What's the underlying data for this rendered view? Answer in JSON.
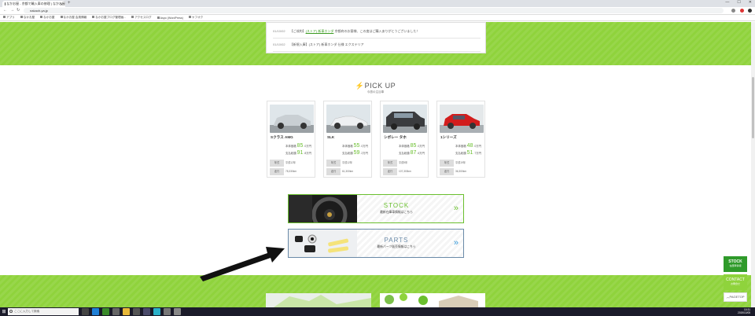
{
  "browser": {
    "tab_title": "なかお屋 - 京都で輸入車の修理 | なかお屋",
    "url": "nakaoh-ya.jp",
    "bookmarks": [
      "アプリ",
      "なかお屋",
      "なかお屋",
      "なかお屋 会員情報",
      "なかお屋ブログ管理画...",
      "アクセスログ",
      "Aspo (WordPress)",
      "ヤフオク"
    ]
  },
  "news": {
    "items": [
      {
        "date": "01/10/02",
        "prefix": "【ご成約】",
        "link": "(ストア) 新車ホンダ",
        "text": "京都府のお客様、この度はご購入ありがとうございました！"
      },
      {
        "date": "01/10/02",
        "prefix": "【新規入庫】",
        "link": "",
        "text": "(ストア) 新車ホンダ 仕様 エクステリア"
      }
    ]
  },
  "pickup": {
    "title": "PICK UP",
    "subtitle": "今週の注目車",
    "price_label_main": "本体価格",
    "price_label_total": "支払総額",
    "price_unit": "万円",
    "spec_year_label": "年式",
    "spec_mileage_label": "走行",
    "cars": [
      {
        "name": "Sクラス AMG",
        "price": "85",
        "price_dec": ".0",
        "total": "91",
        "total_dec": ".8",
        "year": "平成12年",
        "mileage": "78,330km",
        "color": "#c9cfd3"
      },
      {
        "name": "SLK",
        "price": "55",
        "price_dec": ".0",
        "total": "59",
        "total_dec": ".2",
        "year": "平成12年",
        "mileage": "61,300km",
        "color": "#eef0f2"
      },
      {
        "name": "シボレー タホ",
        "price": "85",
        "price_dec": ".0",
        "total": "87",
        "total_dec": ".6",
        "year": "平成9年",
        "mileage": "107,300km",
        "color": "#3a3b3e"
      },
      {
        "name": "1シリーズ",
        "price": "48",
        "price_dec": ".0",
        "total": "51",
        "total_dec": ".7",
        "year": "平成19年",
        "mileage": "36,300km",
        "color": "#d21d1d"
      }
    ]
  },
  "banners": {
    "stock": {
      "title": "STOCK",
      "subtitle": "最新在庫車情報はこちら",
      "color": "#6abf2e"
    },
    "parts": {
      "title": "PARTS",
      "subtitle": "最新パーツ販売情報はこちら",
      "color": "#3a9ad9"
    }
  },
  "side": {
    "stock_title": "STOCK",
    "stock_sub": "在庫車情報",
    "contact_title": "CONTACT",
    "contact_sub": "お問合せ",
    "pagetop": "PAGETOP"
  },
  "taskbar": {
    "search_placeholder": "ここに入力して検索",
    "time": "10:31",
    "date": "2019/10/05"
  }
}
